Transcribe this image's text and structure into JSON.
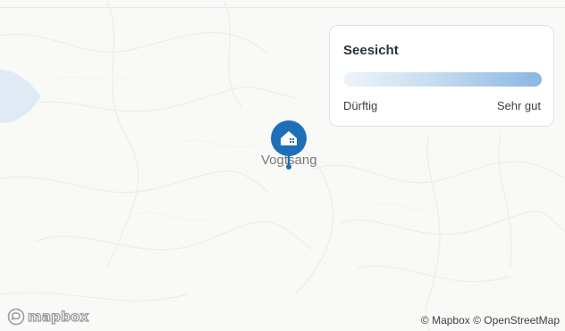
{
  "map": {
    "place_label": "Vogtsang",
    "marker_icon": "home-icon",
    "marker_color": "#1d6fb8"
  },
  "legend": {
    "title": "Seesicht",
    "low_label": "Dürftig",
    "high_label": "Sehr gut",
    "gradient_colors": [
      "#eef5fb",
      "#8ab6e4"
    ]
  },
  "branding": {
    "logo_text": "mapbox",
    "attribution": "© Mapbox © OpenStreetMap"
  }
}
